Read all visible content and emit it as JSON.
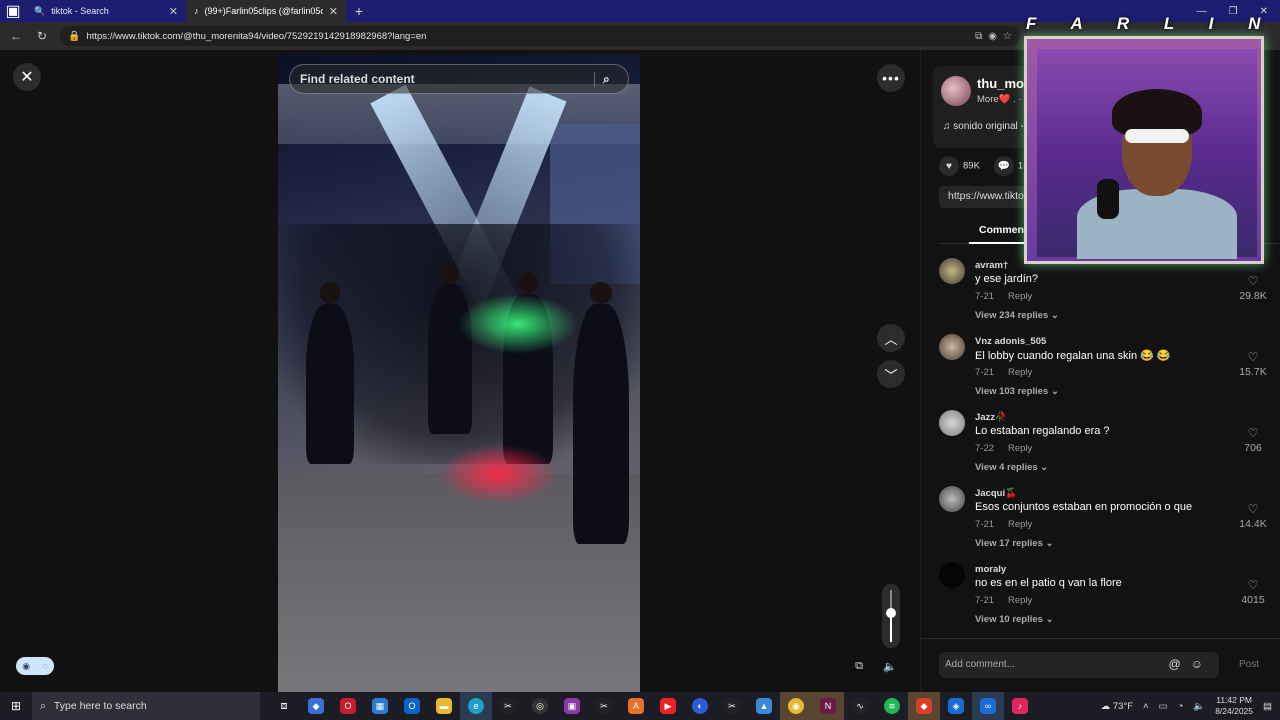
{
  "browser": {
    "tabs": [
      {
        "title": "tiktok - Search",
        "icon": "search-icon",
        "active": false
      },
      {
        "title": "(99+)Farlin05clips (@farlin05clips",
        "icon": "tiktok-icon",
        "active": true
      }
    ],
    "new_tab_label": "+",
    "url": "https://www.tiktok.com/@thu_morenita94/video/7529219142918982968?lang=en"
  },
  "player": {
    "search_placeholder": "Find related content",
    "close_label": "✕",
    "more_label": "•••",
    "volume_level": 0.55
  },
  "author": {
    "username": "thu_more",
    "sub": "More❤️ . · 7",
    "music": "♫  sonido original -"
  },
  "stats": {
    "likes": "89K",
    "comments": "1("
  },
  "link_text": "https://www.tiktok.com/@thu_morenita94/video/752",
  "tabs": {
    "comments_label": "Comments"
  },
  "comments": [
    {
      "user": "avram†",
      "text": "y ese jardín?",
      "date": "7-21",
      "reply": "Reply",
      "replies": "View 234 replies ⌄",
      "likes": "29.8K"
    },
    {
      "user": "Vnz adonis_505",
      "text": "El lobby cuando regalan una skin 😂 😂",
      "date": "7-21",
      "reply": "Reply",
      "replies": "View 103 replies ⌄",
      "likes": "15.7K"
    },
    {
      "user": "Jazz🥀",
      "text": "Lo estaban regalando era ?",
      "date": "7-22",
      "reply": "Reply",
      "replies": "View 4 replies ⌄",
      "likes": "706"
    },
    {
      "user": "Jacqui🍒",
      "text": "Esos conjuntos estaban en promoción o que",
      "date": "7-21",
      "reply": "Reply",
      "replies": "View 17 replies ⌄",
      "likes": "14.4K"
    },
    {
      "user": "moraly",
      "text": "no es en el patio q van la flore",
      "date": "7-21",
      "reply": "Reply",
      "replies": "View 10 replies ⌄",
      "likes": "4015"
    }
  ],
  "add_comment": {
    "placeholder": "Add comment...",
    "post_label": "Post"
  },
  "overlay": {
    "title": "F A R L I N"
  },
  "taskbar": {
    "search_placeholder": "Type here to search",
    "weather": "73°F",
    "time": "11:42 PM",
    "date": "8/24/2025"
  }
}
